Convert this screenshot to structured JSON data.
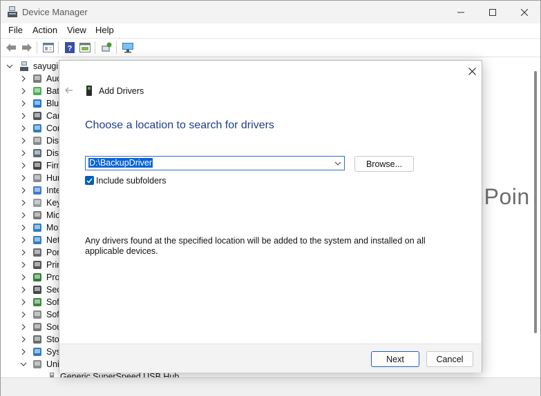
{
  "window": {
    "title": "Device Manager",
    "controls": [
      "minimize",
      "maximize",
      "close"
    ]
  },
  "menu": {
    "items": [
      "File",
      "Action",
      "View",
      "Help"
    ]
  },
  "toolbar": {
    "buttons": [
      "back-arrow",
      "forward-arrow",
      "properties",
      "help",
      "update-driver",
      "scan-hardware",
      "monitor"
    ]
  },
  "tree": {
    "root": "sayugi",
    "categories": [
      {
        "label": "Aud",
        "icon": "speaker-icon"
      },
      {
        "label": "Batt",
        "icon": "battery-icon"
      },
      {
        "label": "Blue",
        "icon": "bluetooth-icon"
      },
      {
        "label": "Car",
        "icon": "camera-icon"
      },
      {
        "label": "Con",
        "icon": "computer-icon"
      },
      {
        "label": "Disk",
        "icon": "disk-icon"
      },
      {
        "label": "Disp",
        "icon": "display-adapter-icon"
      },
      {
        "label": "Firm",
        "icon": "firmware-icon"
      },
      {
        "label": "Hun",
        "icon": "hid-icon"
      },
      {
        "label": "Inte",
        "icon": "chip-icon"
      },
      {
        "label": "Key",
        "icon": "keyboard-icon"
      },
      {
        "label": "Mic",
        "icon": "mouse-icon"
      },
      {
        "label": "Mo",
        "icon": "monitor-icon"
      },
      {
        "label": "Net",
        "icon": "network-icon"
      },
      {
        "label": "Por",
        "icon": "port-icon"
      },
      {
        "label": "Prin",
        "icon": "printer-icon"
      },
      {
        "label": "Pro",
        "icon": "processor-icon"
      },
      {
        "label": "Sec",
        "icon": "security-icon"
      },
      {
        "label": "Soft",
        "icon": "software-component-icon"
      },
      {
        "label": "Soft",
        "icon": "software-device-icon"
      },
      {
        "label": "Sou",
        "icon": "sound-icon"
      },
      {
        "label": "Stor",
        "icon": "storage-icon"
      },
      {
        "label": "Syst",
        "icon": "system-icon"
      },
      {
        "label": "Uni",
        "icon": "usb-icon",
        "expanded": true
      }
    ],
    "child": "Generic SuperSpeed USB Hub"
  },
  "dialog": {
    "title": "Add Drivers",
    "heading": "Choose a location to search for drivers",
    "path_value": "D:\\BackupDriver",
    "browse_label": "Browse...",
    "checkbox_label": "Include subfolders",
    "checkbox_checked": true,
    "description": "Any drivers found at the specified location will be added to the system and installed on all applicable devices.",
    "next_label": "Next",
    "cancel_label": "Cancel"
  },
  "watermark": {
    "text": "WinPoin",
    "colors": [
      "#e8442f",
      "#7cbb2c",
      "#1aa1e3",
      "#f9b81c"
    ]
  },
  "colors": {
    "accent": "#005fb8",
    "heading": "#1f3d8c",
    "selection": "#0a64d8"
  }
}
